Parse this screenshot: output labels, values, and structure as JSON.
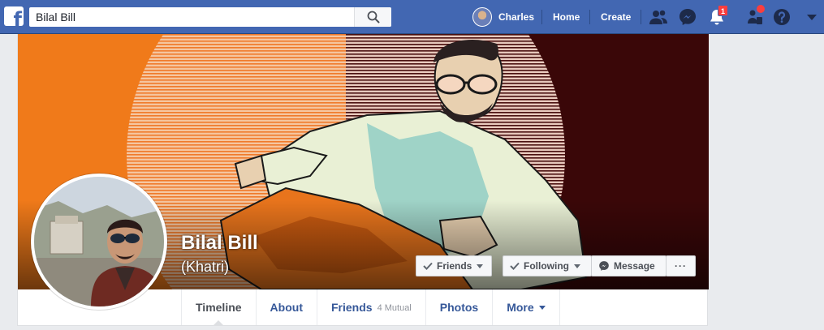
{
  "search": {
    "value": "Bilal Bill"
  },
  "nav": {
    "user_name": "Charles",
    "home": "Home",
    "create": "Create",
    "notifications_count": "1"
  },
  "profile": {
    "name": "Bilal Bill",
    "alternate_name": "(Khatri)"
  },
  "actions": {
    "friends": "Friends",
    "following": "Following",
    "message": "Message",
    "more": "···"
  },
  "tabs": {
    "timeline": "Timeline",
    "about": "About",
    "friends": "Friends",
    "friends_mutual": "4 Mutual",
    "photos": "Photos",
    "more": "More"
  },
  "colors": {
    "brand": "#4267b2",
    "link": "#365899",
    "badge": "#fa3e3e"
  },
  "icons": [
    "facebook-logo-icon",
    "search-icon",
    "friend-requests-icon",
    "messenger-icon",
    "bell-icon",
    "quick-help-icon",
    "help-icon",
    "caret-down-icon",
    "check-icon",
    "messenger-small-icon"
  ]
}
